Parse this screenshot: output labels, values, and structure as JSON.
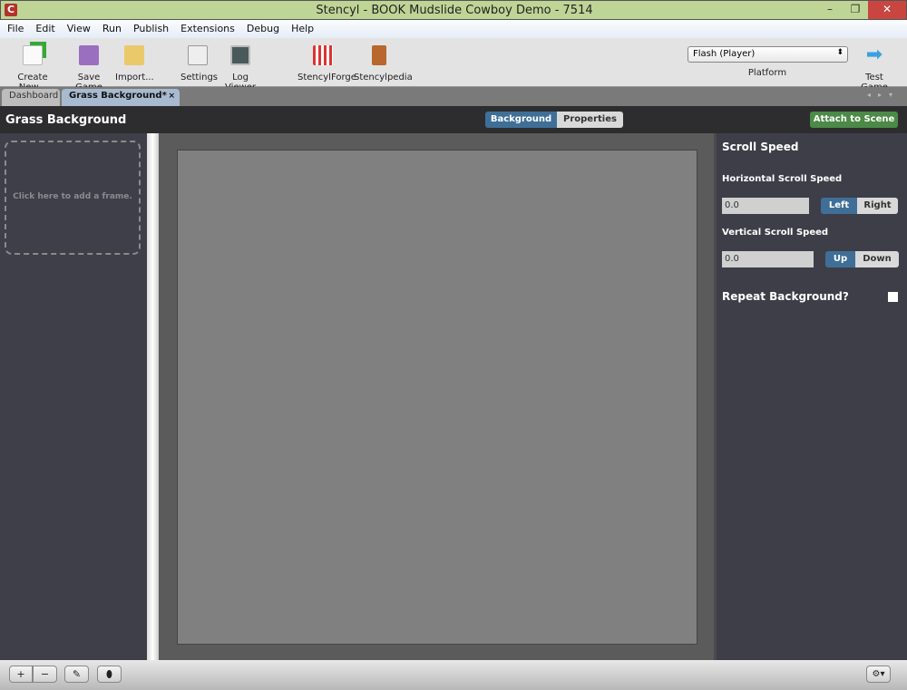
{
  "window": {
    "title": "Stencyl - BOOK Mudslide Cowboy Demo - 7514",
    "icon_letter": "C",
    "minimize": "–",
    "restore": "❐",
    "close": "✕"
  },
  "menu": [
    "File",
    "Edit",
    "View",
    "Run",
    "Publish",
    "Extensions",
    "Debug",
    "Help"
  ],
  "toolbar": {
    "create_new": "Create New...",
    "save_game": "Save Game",
    "import": "Import...",
    "settings": "Settings",
    "log_viewer": "Log Viewer",
    "stencylforge": "StencylForge",
    "stencylpedia": "Stencylpedia",
    "platform_value": "Flash (Player)",
    "platform_label": "Platform",
    "test_game": "Test Game"
  },
  "tabs": {
    "dashboard": "Dashboard",
    "active": "Grass Background*",
    "close": "×",
    "nav": "◂▸▾"
  },
  "header": {
    "title": "Grass Background",
    "mode_background": "Background",
    "mode_properties": "Properties",
    "attach": "Attach to Scene"
  },
  "frames": {
    "add_hint": "Click here to add a frame."
  },
  "properties": {
    "title": "Scroll Speed",
    "h_label": "Horizontal Scroll Speed",
    "h_value": "0.0",
    "h_left": "Left",
    "h_right": "Right",
    "v_label": "Vertical Scroll Speed",
    "v_value": "0.0",
    "v_up": "Up",
    "v_down": "Down",
    "repeat_label": "Repeat Background?",
    "repeat_checked": false
  },
  "bottom": {
    "zoom_in": "+",
    "zoom_out": "−",
    "pencil": "✎",
    "circle": "⬮",
    "gear": "⚙▾"
  },
  "colors": {
    "accent": "#3f6f97",
    "attach": "#4b8a47",
    "titlebar": "#bfd596"
  }
}
